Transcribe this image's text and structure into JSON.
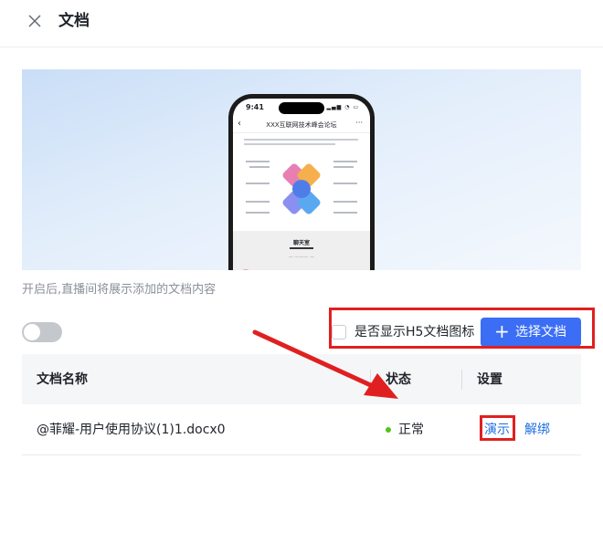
{
  "header": {
    "title": "文档",
    "close_icon": "close-icon"
  },
  "preview": {
    "phone_time": "9:41",
    "phone_title": "XXX互联网技术峰会论坛",
    "chat_title": "聊天室"
  },
  "description": "开启后,直播间将展示添加的文档内容",
  "controls": {
    "toggle_on": false,
    "h5_checkbox_checked": false,
    "h5_checkbox_label": "是否显示H5文档图标",
    "select_button_label": "选择文档",
    "select_button_icon": "plus-icon",
    "accent_color": "#3b6ef5"
  },
  "table": {
    "columns": [
      "文档名称",
      "状态",
      "设置"
    ],
    "rows": [
      {
        "name": "@菲耀-用户使用协议(1)1.docx0",
        "status": "正常",
        "status_color": "#52c41a",
        "actions": [
          "演示",
          "解绑"
        ]
      }
    ]
  },
  "annotation_color": "#e02020"
}
